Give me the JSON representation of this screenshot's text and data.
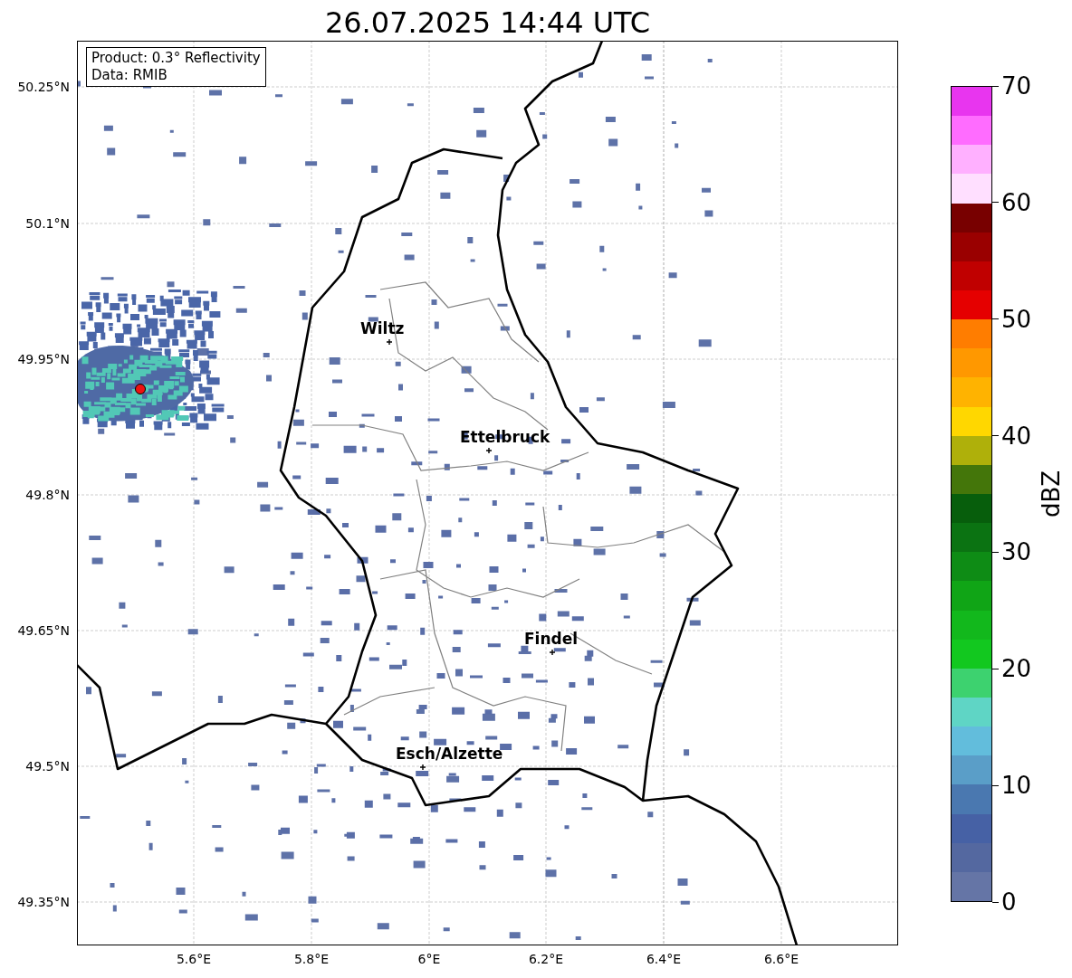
{
  "title": "26.07.2025 14:44 UTC",
  "info_box": [
    "Product: 0.3° Reflectivity",
    "Data: RMIB"
  ],
  "lat_labels": [
    "50.25°N",
    "50.1°N",
    "49.95°N",
    "49.8°N",
    "49.65°N",
    "49.5°N",
    "49.35°N"
  ],
  "lon_labels": [
    "5.6°E",
    "5.8°E",
    "6°E",
    "6.2°E",
    "6.4°E",
    "6.6°E"
  ],
  "cities": [
    {
      "name": "Wiltz"
    },
    {
      "name": "Ettelbruck"
    },
    {
      "name": "Findel"
    },
    {
      "name": "Esch/Alzette"
    }
  ],
  "colorbar": {
    "label": "dBZ",
    "ticks": [
      "70",
      "60",
      "50",
      "40",
      "30",
      "20",
      "10",
      "0"
    ],
    "bins": [
      {
        "color": "#6575a6"
      },
      {
        "color": "#5468a0"
      },
      {
        "color": "#4661a5"
      },
      {
        "color": "#4a78b0"
      },
      {
        "color": "#5a9ec8"
      },
      {
        "color": "#62bddc"
      },
      {
        "color": "#5fd5c5"
      },
      {
        "color": "#3dd26f"
      },
      {
        "color": "#12c81f"
      },
      {
        "color": "#12b81c"
      },
      {
        "color": "#10a516"
      },
      {
        "color": "#0e8c15"
      },
      {
        "color": "#0b7312"
      },
      {
        "color": "#075e0c"
      },
      {
        "color": "#44760a"
      },
      {
        "color": "#afb00a"
      },
      {
        "color": "#ffd700"
      },
      {
        "color": "#ffb300"
      },
      {
        "color": "#ff9800"
      },
      {
        "color": "#ff7d00"
      },
      {
        "color": "#e50000"
      },
      {
        "color": "#c00000"
      },
      {
        "color": "#9a0000"
      },
      {
        "color": "#780000"
      },
      {
        "color": "#ffdfff"
      },
      {
        "color": "#ffb0ff"
      },
      {
        "color": "#ff6cff"
      },
      {
        "color": "#e835ef"
      }
    ]
  }
}
